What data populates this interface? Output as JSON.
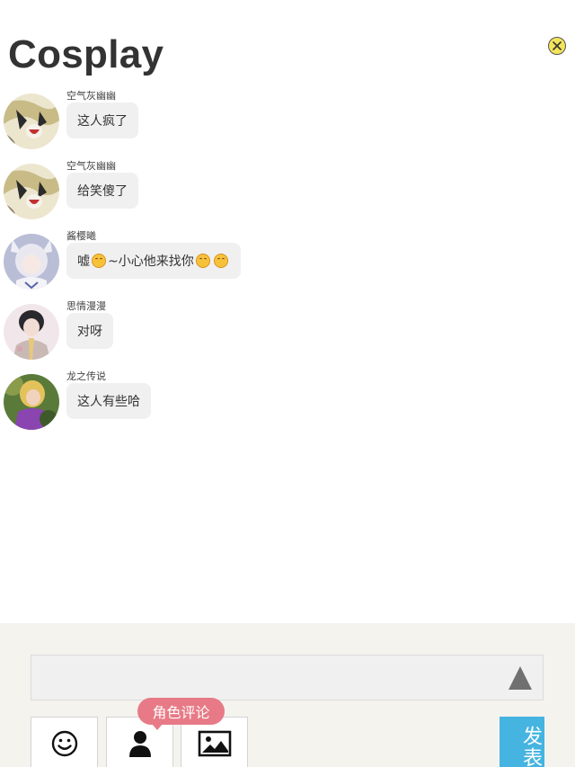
{
  "page": {
    "title": "Cosplay"
  },
  "comments": [
    {
      "user": "空气灰幽幽",
      "parts": [
        "这人疯了"
      ],
      "avatar": "anime-girl-avatar"
    },
    {
      "user": "空气灰幽幽",
      "parts": [
        "给笑傻了"
      ],
      "avatar": "anime-girl-avatar"
    },
    {
      "user": "酱樱曦",
      "parts": [
        "嘘",
        "~小心他来找你",
        "",
        ""
      ],
      "avatar": "silver-hair-avatar"
    },
    {
      "user": "思情漫漫",
      "parts": [
        "对呀"
      ],
      "avatar": "cosplayer-avatar"
    },
    {
      "user": "龙之传说",
      "parts": [
        "这人有些哈"
      ],
      "avatar": "purple-dress-avatar"
    }
  ],
  "composer": {
    "input_value": "",
    "tooltip": "角色评论",
    "publish_label": "发表",
    "tools": [
      "smiley-icon",
      "person-icon",
      "image-icon"
    ]
  },
  "colors": {
    "tooltip": "#e77a86",
    "publish": "#45b4e0",
    "panel": "#f4f3ee",
    "bubble": "#f0f0f0"
  }
}
